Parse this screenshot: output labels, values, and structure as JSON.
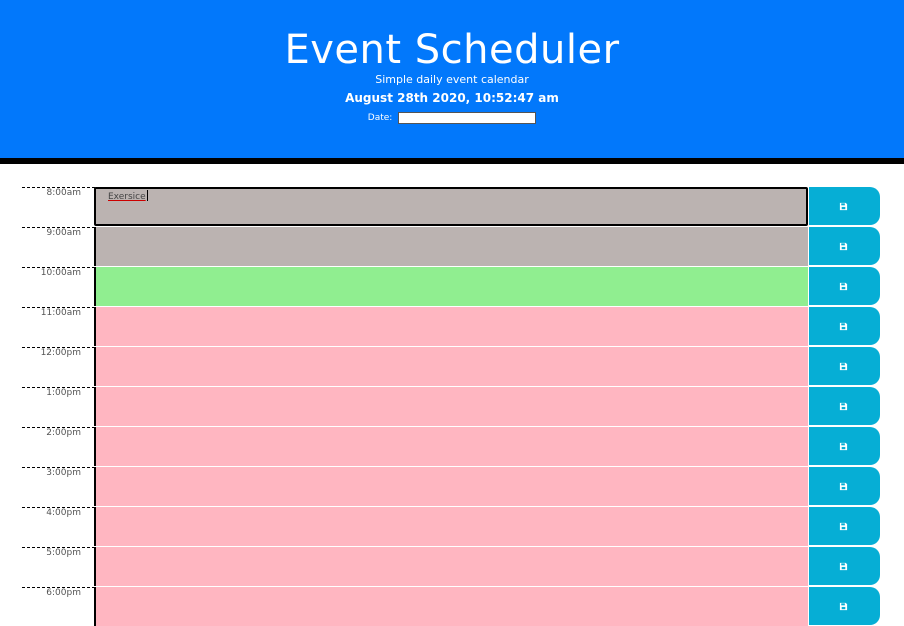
{
  "header": {
    "title": "Event Scheduler",
    "subtitle": "Simple daily event calendar",
    "clock": "August 28th 2020, 10:52:47 am",
    "date_label": "Date:",
    "date_value": ""
  },
  "colors": {
    "header_bg": "#0278fb",
    "past": "#bbb3b1",
    "present": "#90ee90",
    "future": "#ffb6c1",
    "save_button": "#06aed5"
  },
  "rows": [
    {
      "hour": "8:00am",
      "state": "past",
      "text": "Exersice",
      "icon": "save-icon"
    },
    {
      "hour": "9:00am",
      "state": "past",
      "text": "",
      "icon": "save-icon"
    },
    {
      "hour": "10:00am",
      "state": "present",
      "text": "",
      "icon": "save-icon"
    },
    {
      "hour": "11:00am",
      "state": "future",
      "text": "",
      "icon": "save-icon"
    },
    {
      "hour": "12:00pm",
      "state": "future",
      "text": "",
      "icon": "save-icon"
    },
    {
      "hour": "1:00pm",
      "state": "future",
      "text": "",
      "icon": "save-icon"
    },
    {
      "hour": "2:00pm",
      "state": "future",
      "text": "",
      "icon": "save-icon"
    },
    {
      "hour": "3:00pm",
      "state": "future",
      "text": "",
      "icon": "save-icon"
    },
    {
      "hour": "4:00pm",
      "state": "future",
      "text": "",
      "icon": "save-icon"
    },
    {
      "hour": "5:00pm",
      "state": "future",
      "text": "",
      "icon": "save-icon"
    },
    {
      "hour": "6:00pm",
      "state": "future",
      "text": "",
      "icon": "save-icon"
    }
  ]
}
